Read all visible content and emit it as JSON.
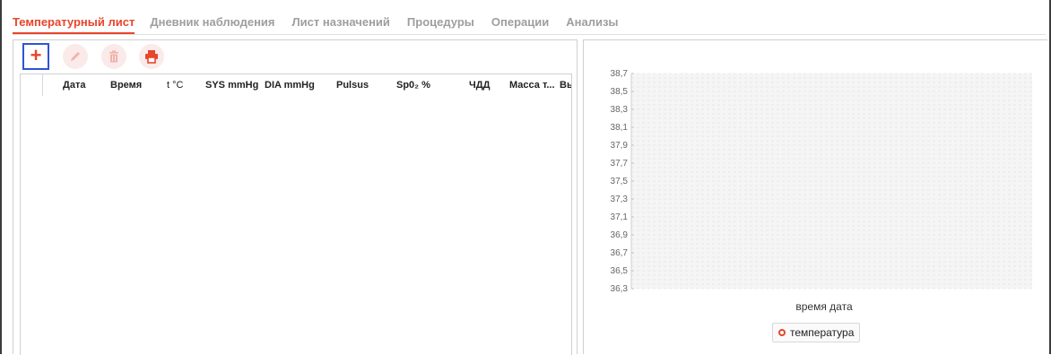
{
  "tabs": [
    {
      "label": "Температурный лист",
      "active": true
    },
    {
      "label": "Дневник наблюдения",
      "active": false
    },
    {
      "label": "Лист назначений",
      "active": false
    },
    {
      "label": "Процедуры",
      "active": false
    },
    {
      "label": "Операции",
      "active": false
    },
    {
      "label": "Анализы",
      "active": false
    }
  ],
  "toolbar": {
    "add_icon": "plus-icon",
    "edit_icon": "pencil-icon",
    "delete_icon": "trash-icon",
    "print_icon": "printer-icon"
  },
  "table": {
    "columns": [
      "Дата",
      "Время",
      "t °C",
      "SYS mmHg",
      "DIA mmHg",
      "Pulsus",
      "Sp0₂ %",
      "ЧДД",
      "Масса т...",
      "Вы"
    ],
    "rows": []
  },
  "chart_data": {
    "type": "line",
    "y_ticks": [
      "38,7",
      "38,5",
      "38,3",
      "38,1",
      "37,9",
      "37,7",
      "37,5",
      "37,3",
      "37,1",
      "36,9",
      "36,7",
      "36,5",
      "36,3"
    ],
    "ylim": [
      36.3,
      38.7
    ],
    "xlabel": "время дата",
    "ylabel": "",
    "grid": true,
    "legend_position": "bottom",
    "series": [
      {
        "name": "температура",
        "values": []
      }
    ],
    "colors": {
      "series": "#e8452a"
    }
  },
  "colors": {
    "accent": "#e8452a",
    "focus": "#2f54d6"
  }
}
